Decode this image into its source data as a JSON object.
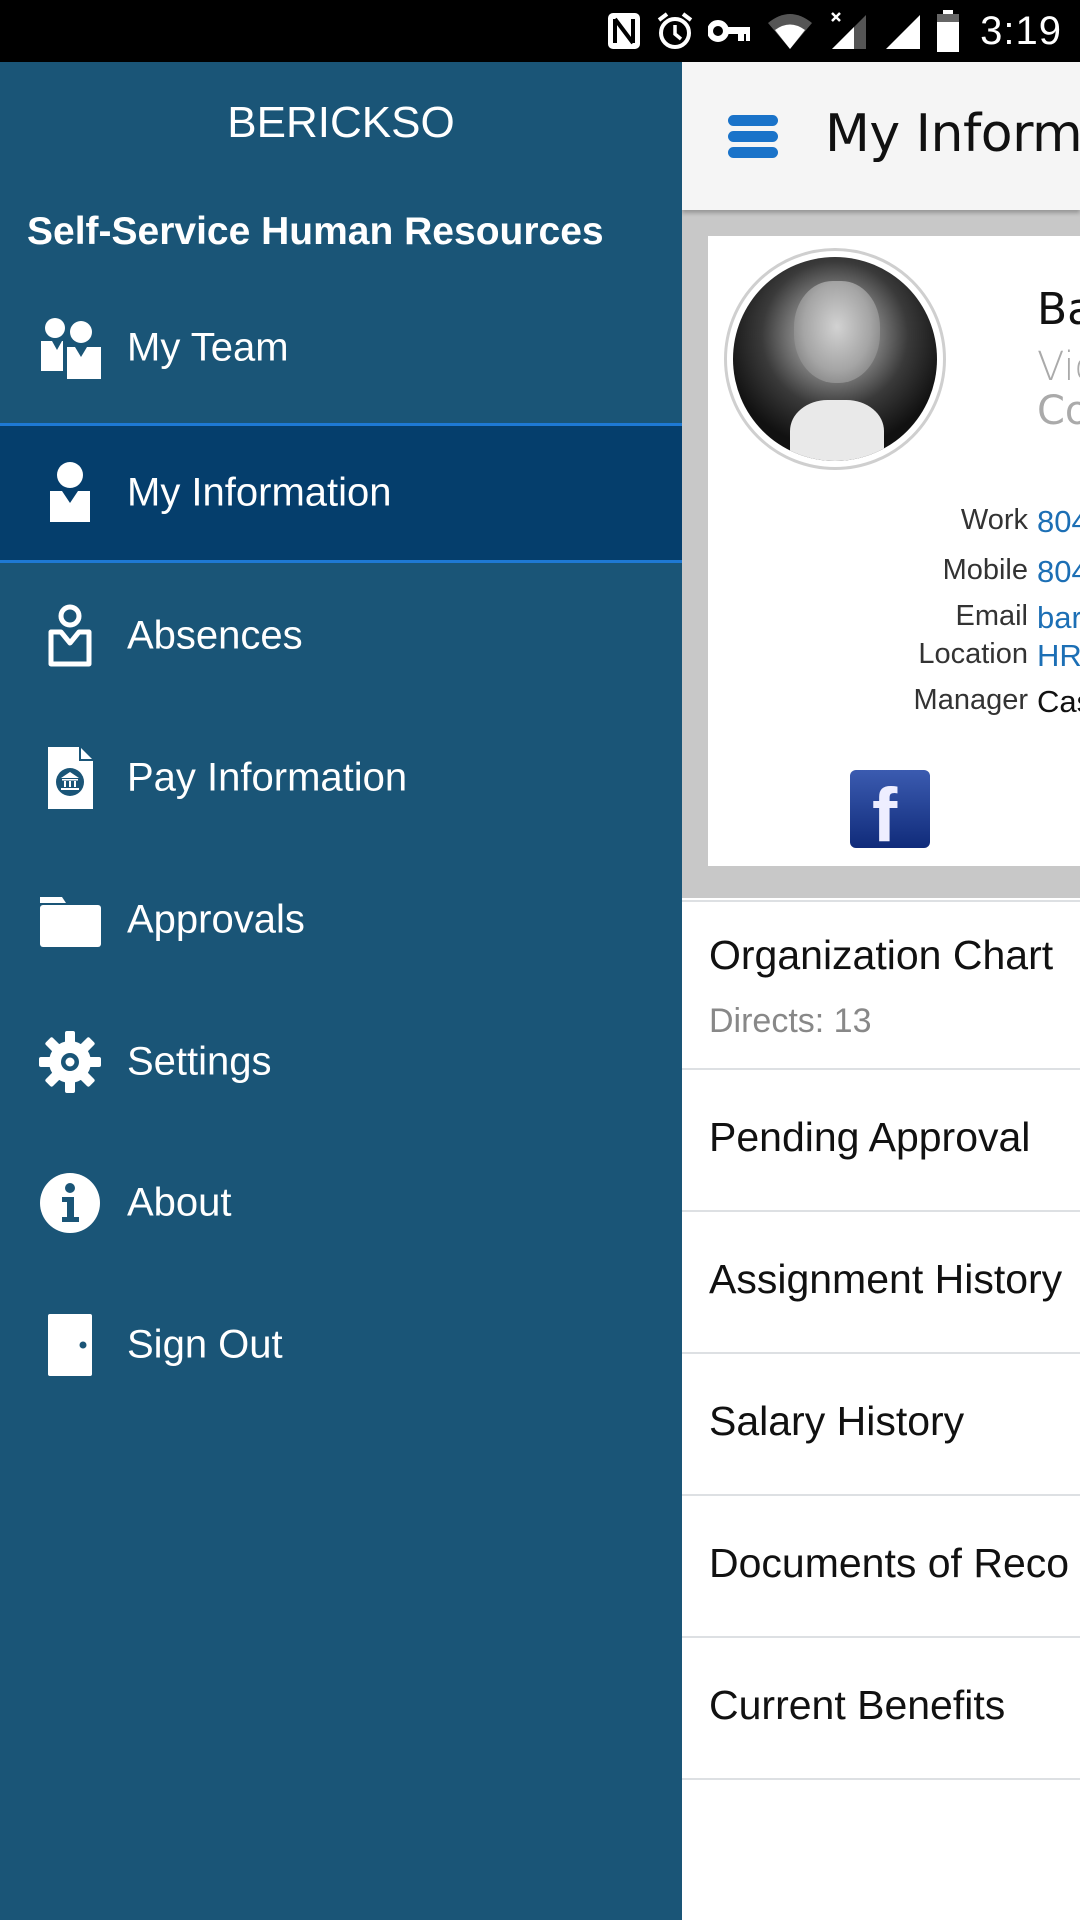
{
  "status_bar": {
    "time": "3:19",
    "icons": [
      "nfc-icon",
      "alarm-icon",
      "vpn-key-icon",
      "wifi-icon",
      "signal-no-data-icon",
      "signal-icon",
      "battery-icon"
    ]
  },
  "drawer": {
    "username": "BERICKSO",
    "app_name": "Self-Service Human Resources",
    "items": [
      {
        "label": "My Team",
        "icon": "team-icon",
        "active": false
      },
      {
        "label": "My Information",
        "icon": "person-icon",
        "active": true
      },
      {
        "label": "Absences",
        "icon": "absence-person-icon",
        "active": false
      },
      {
        "label": "Pay Information",
        "icon": "pay-document-icon",
        "active": false
      },
      {
        "label": "Approvals",
        "icon": "folder-icon",
        "active": false
      },
      {
        "label": "Settings",
        "icon": "gear-icon",
        "active": false
      },
      {
        "label": "About",
        "icon": "info-icon",
        "active": false
      },
      {
        "label": "Sign Out",
        "icon": "door-icon",
        "active": false
      }
    ]
  },
  "main": {
    "title": "My Informa",
    "profile": {
      "name": "Ba",
      "job_title": "Vic",
      "department": "Co",
      "fields": [
        {
          "label": "Work",
          "value": "804",
          "link": true
        },
        {
          "label": "Mobile",
          "value": "804",
          "link": true
        },
        {
          "label": "Email",
          "value": "bar",
          "link": true
        },
        {
          "label": "Location",
          "value": "HR",
          "link": true
        },
        {
          "label": "Manager",
          "value": "Cas",
          "link": false
        }
      ],
      "social": "facebook-icon",
      "social_glyph": "f"
    },
    "list": [
      {
        "title": "Organization Chart",
        "subtitle": "Directs:  13"
      },
      {
        "title": "Pending Approval"
      },
      {
        "title": "Assignment History"
      },
      {
        "title": "Salary History"
      },
      {
        "title": "Documents of Reco"
      },
      {
        "title": "Current Benefits"
      }
    ]
  },
  "colors": {
    "drawer_bg": "#1a5577",
    "drawer_active_bg": "#053e6c",
    "accent": "#1e79d4",
    "link": "#1c6fb5",
    "hamburger": "#1a73c9"
  }
}
